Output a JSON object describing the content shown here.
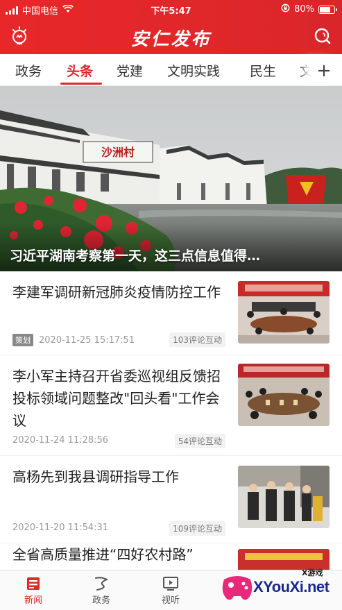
{
  "status_bar": {
    "carrier": "中国电信",
    "time": "下午5:47",
    "battery": "80%",
    "battery_level": 0.8
  },
  "header": {
    "app_title": "安仁发布",
    "left_icon": "lightbulb-icon",
    "right_icon": "search-icon"
  },
  "tabs": [
    {
      "label": "政务",
      "active": false
    },
    {
      "label": "头条",
      "active": true
    },
    {
      "label": "党建",
      "active": false
    },
    {
      "label": "文明实践",
      "active": false
    },
    {
      "label": "民生",
      "active": false
    },
    {
      "label": "文",
      "active": false
    }
  ],
  "tab_more_label": "+",
  "hero": {
    "caption": "习近平湖南考察第一天，这三点信息值得…",
    "sign_text": "沙洲村"
  },
  "news": [
    {
      "title": "李建军调研新冠肺炎疫情防控工作",
      "tag": "策划",
      "date": "2020-11-25 15:17:51",
      "comments": "103评论互动"
    },
    {
      "title": "李小军主持召开省委巡视组反馈招投标领域问题整改\"回头看\"工作会议",
      "tag": "",
      "date": "2020-11-24 11:28:56",
      "comments": "54评论互动"
    },
    {
      "title": "高杨先到我县调研指导工作",
      "tag": "",
      "date": "2020-11-20 11:54:31",
      "comments": "109评论互动"
    },
    {
      "title": "全省高质量推进“四好农村路”",
      "tag": "",
      "date": "",
      "comments": ""
    }
  ],
  "tabbar": [
    {
      "label": "新闻",
      "icon": "news-icon",
      "active": true
    },
    {
      "label": "政务",
      "icon": "government-icon",
      "active": false
    },
    {
      "label": "视听",
      "icon": "video-icon",
      "active": false
    }
  ],
  "watermark": {
    "small": "X游戏",
    "main": "XYouXi.net"
  },
  "colors": {
    "brand": "#e0272a",
    "text": "#222222",
    "meta": "#999999"
  }
}
